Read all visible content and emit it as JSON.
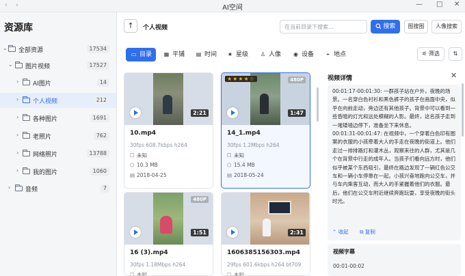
{
  "titlebar": {
    "title": "AI空间",
    "back": "‹",
    "forward": "›",
    "minimize": "—",
    "maximize": "□",
    "close": "✕"
  },
  "sidebar": {
    "title": "资源库",
    "items": [
      {
        "label": "全部资源",
        "count": "17534",
        "active": false
      },
      {
        "label": "图片视频",
        "count": "17527",
        "active": false
      },
      {
        "label": "AI图片",
        "count": "14",
        "active": false
      },
      {
        "label": "个人视频",
        "count": "212",
        "active": true
      },
      {
        "label": "各种图片",
        "count": "1691",
        "active": false
      },
      {
        "label": "老照片",
        "count": "762",
        "active": false
      },
      {
        "label": "网络照片",
        "count": "13788",
        "active": false
      },
      {
        "label": "我的图片",
        "count": "1060",
        "active": false
      },
      {
        "label": "音频",
        "count": "7",
        "active": false
      }
    ]
  },
  "toolbar": {
    "up_icon": "↑",
    "folder_title": "个人视频",
    "search_placeholder": "在当前目录下搜索...",
    "search_label": "搜索",
    "image_search_label": "图搜图",
    "person_search_label": "人像搜索"
  },
  "view_tabs": [
    {
      "label": "目录",
      "icon": "folder-icon",
      "active": true
    },
    {
      "label": "平铺",
      "icon": "grid-icon",
      "active": false
    },
    {
      "label": "时间",
      "icon": "calendar-icon",
      "active": false
    },
    {
      "label": "星级",
      "icon": "star-icon",
      "active": false
    },
    {
      "label": "人像",
      "icon": "person-icon",
      "active": false
    },
    {
      "label": "设备",
      "icon": "camera-icon",
      "active": false
    },
    {
      "label": "地点",
      "icon": "location-icon",
      "active": false
    }
  ],
  "filter": {
    "label": "筛选",
    "sort_icon": "sort-icon"
  },
  "cards": [
    {
      "name": "10.mp4",
      "meta": "30fps 608.7kbps h264",
      "rating": "未知",
      "size": "10.3 MB",
      "date": "2018-04-25",
      "duration": "2:21",
      "badge": "",
      "stars": "",
      "selected": false
    },
    {
      "name": "14_1.mp4",
      "meta": "30fps 1.2Mbps h264",
      "rating": "未知",
      "size": "15.4 MB",
      "date": "2018-05-24",
      "duration": "1:47",
      "badge": "480P",
      "stars": "★★★★☆",
      "selected": true
    },
    {
      "name": "16 (3).mp4",
      "meta": "30fps 1.18Mbps h264",
      "rating": "未知",
      "size": "",
      "date": "",
      "duration": "1:51",
      "badge": "480P",
      "stars": "",
      "selected": false
    },
    {
      "name": "1606385156303.mp4",
      "meta": "29fps 601.6kbps h264 bt709",
      "rating": "未知",
      "size": "",
      "date": "",
      "duration": "2:31",
      "badge": "",
      "stars": "",
      "selected": false
    }
  ],
  "details": {
    "title": "视频详情",
    "close_icon": "✕",
    "description": [
      "00:01:17-00:01:30: 一群孩子站在户外，夜晚的场景。一名穿白色衬衫和黑色裤子的孩子在画面中央，似乎在向前走动，旁边还有其他孩子。背景中可以看到一些昏暗的灯光和远处模糊的人影。最终，这名孩子走到一堵矮墙边停下，准备坐下来休息。",
      "00:01:31-00:01:47: 在视频中，一个穿着白色印有图案的衣服的小孩牵着大人的手走在夜晚的街道上。他们走过一排排路灯和灌木丛，观察来往的人群，尤其是几个在背景中行走的成年人。当孩子们看向远方时，他们似乎被某个东西吸引，最终在路边发现了一辆红色公交车和一辆小车停靠在一起。小孩兴奋地跑向公交车，并与车内乘客互动，而大人的手紧握着他们的衣服。最后，他们在公交车附近继续奔跑玩耍，享受夜晚的街头时光。"
    ],
    "collapse_label": "收起",
    "copy_label": "复制",
    "subtitle_title": "视频字幕",
    "subtitle_time": "00:01-00:02"
  }
}
